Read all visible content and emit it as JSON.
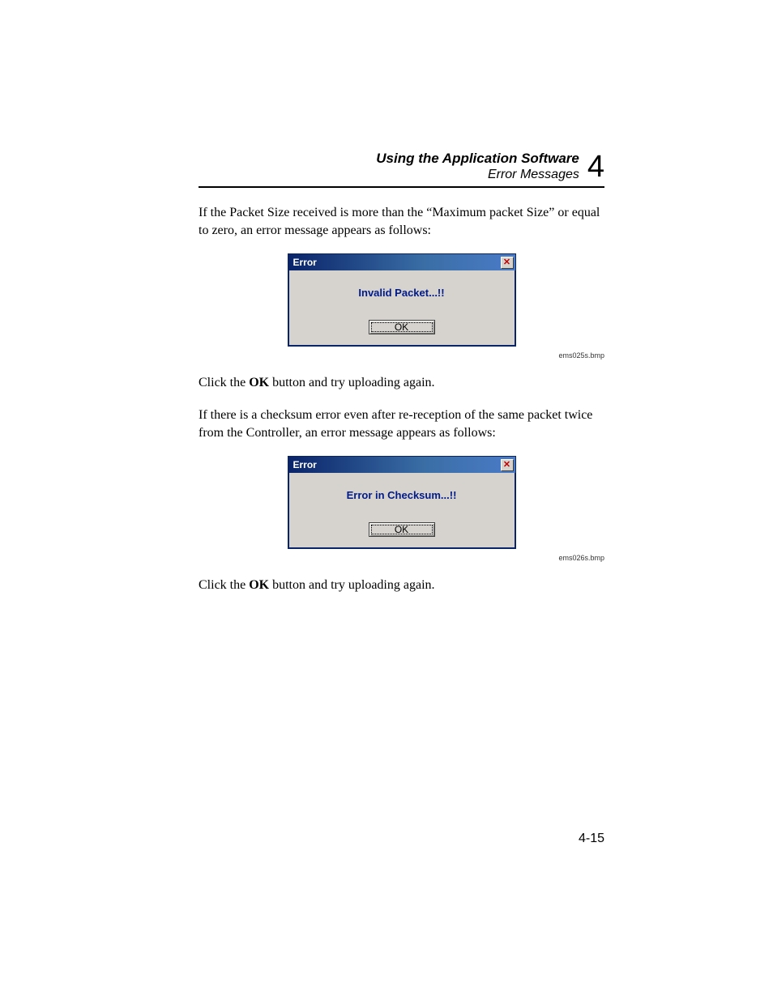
{
  "header": {
    "title": "Using the Application Software",
    "subtitle": "Error Messages",
    "chapter_number": "4"
  },
  "paragraphs": {
    "p1": "If the Packet Size received is more than the “Maximum packet Size” or equal to zero, an error message appears as follows:",
    "p2a": "Click the ",
    "p2b": "OK",
    "p2c": " button and try uploading again.",
    "p3": "If there is a checksum error even after re-reception of the same packet twice from the Controller, an error message appears as follows:",
    "p4a": "Click the ",
    "p4b": "OK",
    "p4c": " button and try uploading again."
  },
  "dialog1": {
    "title": "Error",
    "message": "Invalid Packet...!!",
    "ok": "OK",
    "caption": "ems025s.bmp"
  },
  "dialog2": {
    "title": "Error",
    "message": "Error in Checksum...!!",
    "ok": "OK",
    "caption": "ems026s.bmp"
  },
  "page_number": "4-15"
}
